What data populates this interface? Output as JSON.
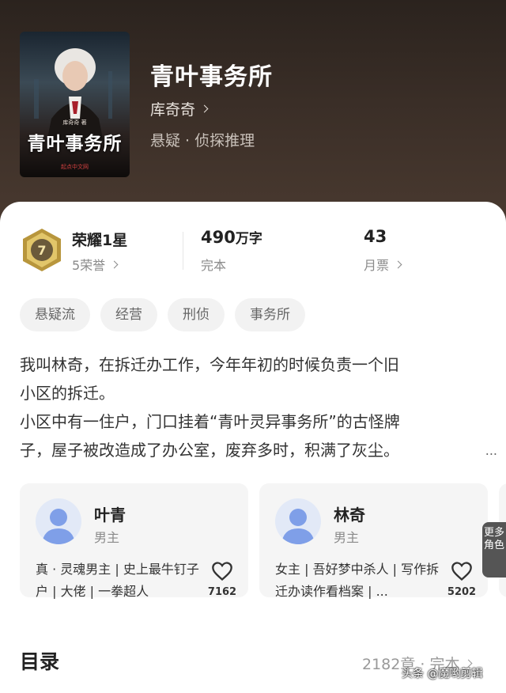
{
  "book": {
    "title": "青叶事务所",
    "author": "库奇奇",
    "genre": "悬疑 · 侦探推理",
    "cover": {
      "title": "青叶事务所",
      "author": "库奇奇 著",
      "publisher": "起点中文网"
    }
  },
  "stats": {
    "rank_title": "荣耀1星",
    "rank_sub": "5荣誉",
    "medal_number": "7",
    "word_count": "490",
    "word_unit": "万字",
    "status": "完本",
    "votes": "43",
    "votes_label": "月票"
  },
  "tags": [
    "悬疑流",
    "经营",
    "刑侦",
    "事务所"
  ],
  "intro": {
    "line1": "我叫林奇，在拆迁办工作，今年年初的时候负责一个旧",
    "line2": "小区的拆迁。",
    "line3": "小区中有一住户，门口挂着“青叶灵异事务所”的古怪牌",
    "line4": "子，屋子被改造成了办公室，废弃多时，积满了灰尘。",
    "more": "..."
  },
  "characters": [
    {
      "name": "叶青",
      "role": "男主",
      "desc": "真 · 灵魂男主 | 史上最牛钉子户 | 大佬 | 一拳超人",
      "likes": "7162"
    },
    {
      "name": "林奇",
      "role": "男主",
      "desc": "女主 | 吾好梦中杀人 | 写作拆迁办读作看档案 | ...",
      "likes": "5202"
    }
  ],
  "more_roles": "更多角色",
  "catalog": {
    "title": "目录",
    "info": "2182章 · 完本"
  },
  "watermark": "头条 @魔哟剪辑",
  "colors": {
    "hero_bg": "#3a2e27",
    "medal_gold": "#c9a84a",
    "avatar_blue": "#6f93e6"
  }
}
